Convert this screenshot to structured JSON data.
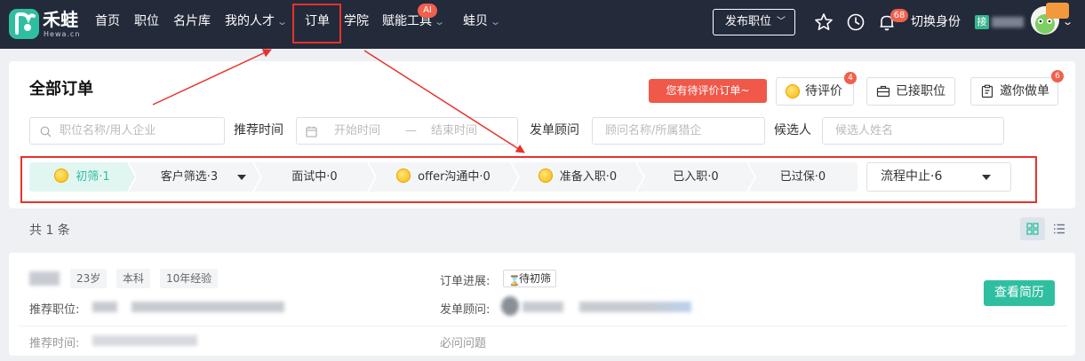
{
  "brand": {
    "name": "禾蛙",
    "sub": "Hewa.cn"
  },
  "nav": {
    "items": [
      {
        "label": "首页"
      },
      {
        "label": "职位"
      },
      {
        "label": "名片库"
      },
      {
        "label": "我的人才",
        "has_dropdown": true
      },
      {
        "label": "订单",
        "highlighted": true
      },
      {
        "label": "学院"
      },
      {
        "label": "赋能工具",
        "has_dropdown": true,
        "badge": "AI"
      },
      {
        "label": "蛙贝",
        "has_dropdown": true
      }
    ],
    "publish_button": "发布职位",
    "notification_count": "68",
    "switch_identity": "切换身份",
    "company_tag": "接"
  },
  "page": {
    "title": "全部订单",
    "pending_tip": "您有待评价订单~",
    "actions": [
      {
        "label": "待评价",
        "badge": "4",
        "icon": "coin-icon"
      },
      {
        "label": "已接职位",
        "icon": "briefcase-icon"
      },
      {
        "label": "邀你做单",
        "badge": "6",
        "icon": "clipboard-icon"
      }
    ]
  },
  "filters": {
    "job_placeholder": "职位名称/用人企业",
    "recommend_time_label": "推荐时间",
    "start_placeholder": "开始时间",
    "range_sep": "—",
    "end_placeholder": "结束时间",
    "consultant_label": "发单顾问",
    "consultant_placeholder": "顾问名称/所属猎企",
    "candidate_label": "候选人",
    "candidate_placeholder": "候选人姓名"
  },
  "stages": [
    {
      "label": "初筛·1",
      "active": true,
      "coin": true
    },
    {
      "label": "客户筛选·3",
      "dropdown": true
    },
    {
      "label": "面试中·0"
    },
    {
      "label": "offer沟通中·0",
      "coin": true
    },
    {
      "label": "准备入职·0",
      "coin": true
    },
    {
      "label": "已入职·0"
    },
    {
      "label": "已过保·0"
    }
  ],
  "stage_dropdown": "流程中止·6",
  "results": {
    "total": "共 1 条",
    "card": {
      "age": "23岁",
      "education": "本科",
      "experience": "10年经验",
      "recommend_job_label": "推荐职位:",
      "order_progress_label": "订单进展:",
      "status": "待初筛",
      "consultant_label": "发单顾问:",
      "recommend_time_label": "推荐时间:",
      "required_questions": "必问问题",
      "view_resume": "查看简历"
    }
  },
  "colors": {
    "nav_bg": "#232a3a",
    "brand": "#2fbfa0",
    "alert": "#f0584a",
    "annotation": "#e8312b"
  }
}
